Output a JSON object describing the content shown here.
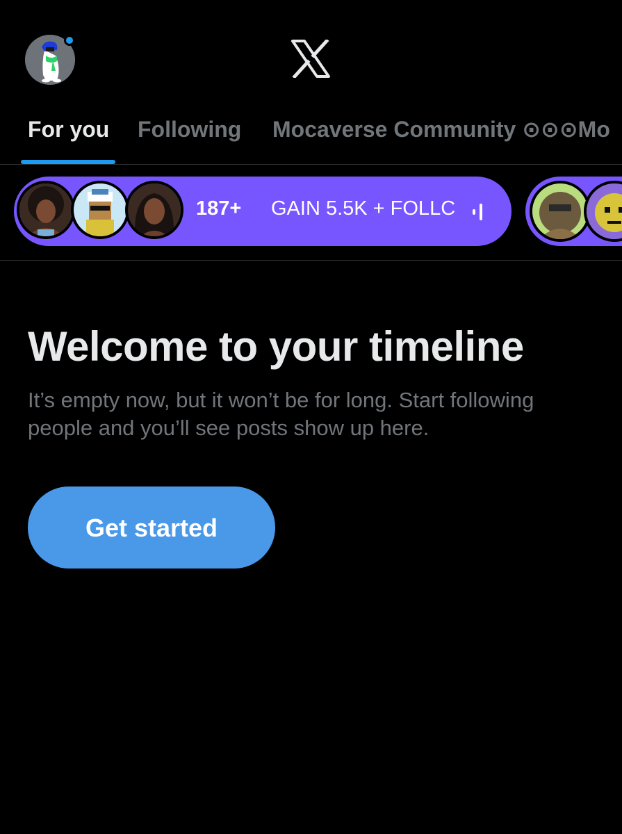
{
  "header": {
    "logo": "X",
    "avatar_icon": "penguin-avatar",
    "notification_color": "#1d9bf0"
  },
  "tabs": [
    {
      "label": "For you",
      "active": true
    },
    {
      "label": "Following",
      "active": false
    },
    {
      "label": "Mocaverse Community ⊙⊙⊙Mo",
      "active": false
    }
  ],
  "spaces": {
    "live_space": {
      "listener_count": "187+",
      "title": "GAIN 5.5K + FOLLC",
      "color": "#7856ff"
    }
  },
  "empty_state": {
    "title": "Welcome to your timeline",
    "text": "It’s empty now, but it won’t be for long. Start following people and you’ll see posts show up here.",
    "button_label": "Get started",
    "button_color": "#4a99e9"
  },
  "colors": {
    "background": "#000000",
    "accent": "#1d9bf0",
    "muted_text": "#71767b"
  }
}
